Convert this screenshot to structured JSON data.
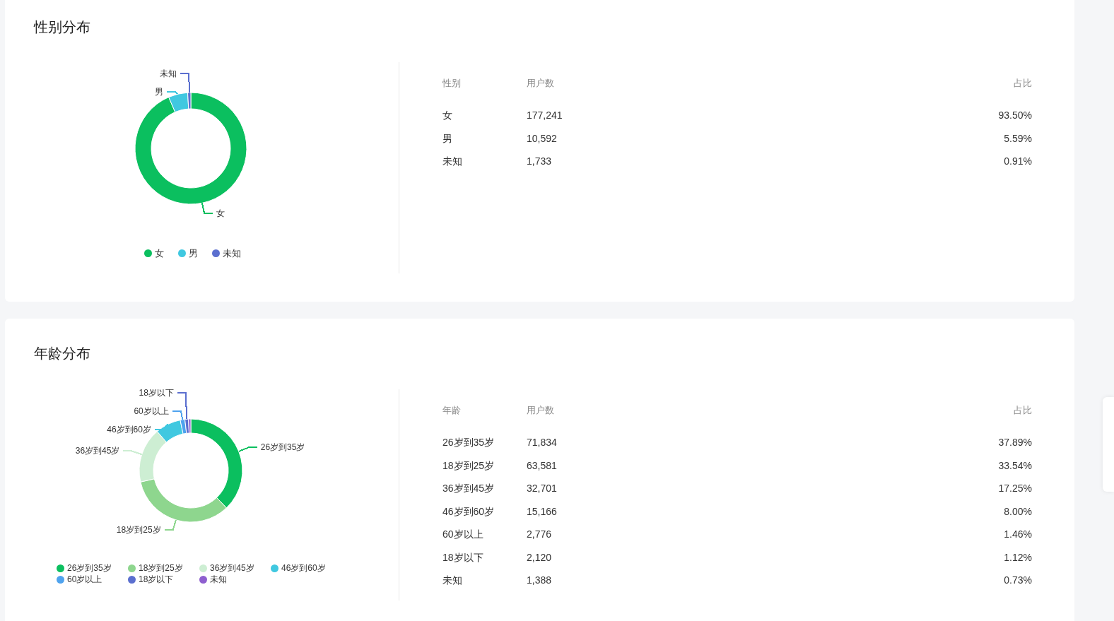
{
  "sections": [
    {
      "title": "性别分布",
      "chart_data": {
        "type": "donut",
        "values": [
          93.5,
          5.59,
          0.91
        ]
      },
      "slice_labels": [
        {
          "text": "未知",
          "color": "#5b6fcf"
        },
        {
          "text": "男",
          "color": "#40c8e0"
        },
        {
          "text": "女",
          "color": "#0bbf5f"
        }
      ],
      "legend": [
        {
          "label": "女",
          "color": "#0bbf5f"
        },
        {
          "label": "男",
          "color": "#40c8e0"
        },
        {
          "label": "未知",
          "color": "#5b6fcf"
        }
      ],
      "table": {
        "columns": [
          "性别",
          "用户数",
          "占比"
        ],
        "rows": [
          [
            "女",
            "177,241",
            "93.50%"
          ],
          [
            "男",
            "10,592",
            "5.59%"
          ],
          [
            "未知",
            "1,733",
            "0.91%"
          ]
        ]
      }
    },
    {
      "title": "年龄分布",
      "chart_data": {
        "type": "donut",
        "values": [
          37.89,
          33.54,
          17.25,
          8.0,
          1.46,
          1.12,
          0.73
        ]
      },
      "slice_labels": [
        {
          "text": "18岁以下",
          "color": "#5b6fcf"
        },
        {
          "text": "60岁以上",
          "color": "#4fa3ee"
        },
        {
          "text": "46岁到60岁",
          "color": "#40c8e0"
        },
        {
          "text": "26岁到35岁",
          "color": "#0bbf5f"
        },
        {
          "text": "36岁到45岁",
          "color": "#cdeed3"
        },
        {
          "text": "18岁到25岁",
          "color": "#8ed68e"
        }
      ],
      "legend": [
        {
          "label": "26岁到35岁",
          "color": "#0bbf5f"
        },
        {
          "label": "18岁到25岁",
          "color": "#8ed68e"
        },
        {
          "label": "36岁到45岁",
          "color": "#cdeed3"
        },
        {
          "label": "46岁到60岁",
          "color": "#40c8e0"
        },
        {
          "label": "60岁以上",
          "color": "#4fa3ee"
        },
        {
          "label": "18岁以下",
          "color": "#5b6fcf"
        },
        {
          "label": "未知",
          "color": "#8e5fcf"
        }
      ],
      "table": {
        "columns": [
          "年龄",
          "用户数",
          "占比"
        ],
        "rows": [
          [
            "26岁到35岁",
            "71,834",
            "37.89%"
          ],
          [
            "18岁到25岁",
            "63,581",
            "33.54%"
          ],
          [
            "36岁到45岁",
            "32,701",
            "17.25%"
          ],
          [
            "46岁到60岁",
            "15,166",
            "8.00%"
          ],
          [
            "60岁以上",
            "2,776",
            "1.46%"
          ],
          [
            "18岁以下",
            "2,120",
            "1.12%"
          ],
          [
            "未知",
            "1,388",
            "0.73%"
          ]
        ]
      }
    }
  ]
}
